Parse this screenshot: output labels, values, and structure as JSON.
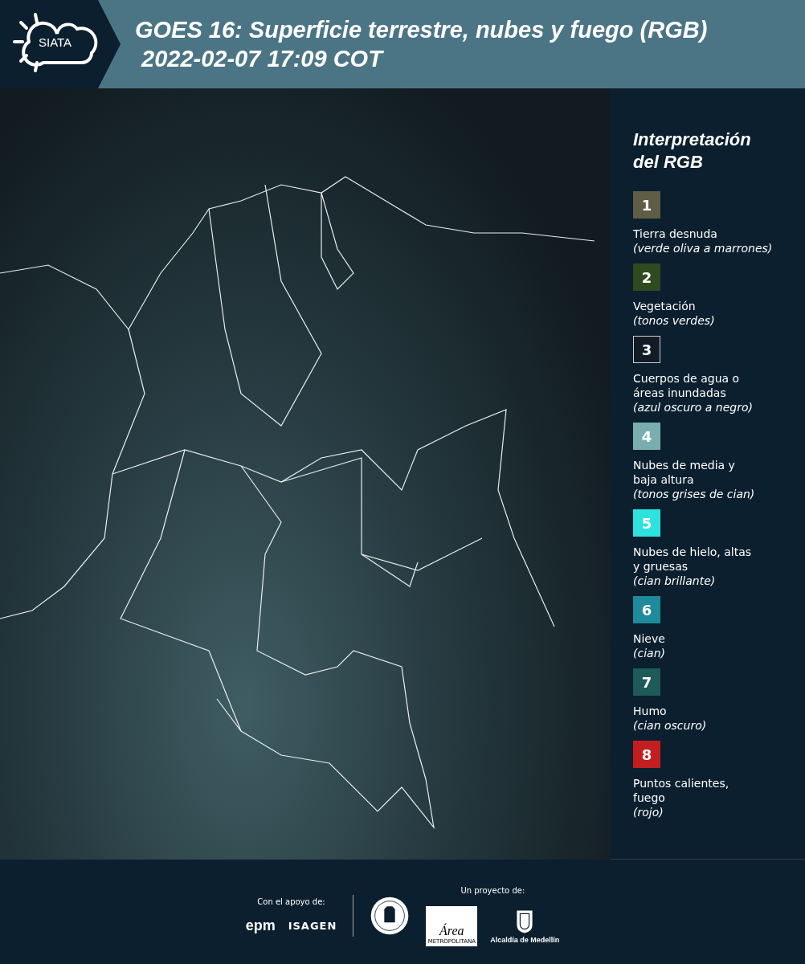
{
  "header": {
    "logo": "SIATA",
    "title": "GOES 16: Superficie terrestre, nubes y fuego (RGB)",
    "timestamp": "2022-02-07 17:09 COT"
  },
  "legend": {
    "title": "Interpretación del RGB",
    "items": [
      {
        "number": "1",
        "color": "#5f5e44",
        "outlined": false,
        "label": "Tierra desnuda",
        "note": "(verde oliva a marrones)"
      },
      {
        "number": "2",
        "color": "#2f4a20",
        "outlined": false,
        "label": "Vegetación",
        "note": "(tonos verdes)"
      },
      {
        "number": "3",
        "color": "#121c26",
        "outlined": true,
        "label": "Cuerpos de agua o áreas inundadas",
        "note": "(azul oscuro a negro)"
      },
      {
        "number": "4",
        "color": "#7aaeae",
        "outlined": false,
        "label": "Nubes de media y baja altura",
        "note": "(tonos grises de cian)"
      },
      {
        "number": "5",
        "color": "#2ee2de",
        "outlined": false,
        "label": "Nubes de hielo, altas y gruesas",
        "note": "(cian brillante)"
      },
      {
        "number": "6",
        "color": "#1e8a9b",
        "outlined": false,
        "label": "Nieve",
        "note": "(cian)"
      },
      {
        "number": "7",
        "color": "#1d5a58",
        "outlined": false,
        "label": "Humo",
        "note": "(cian oscuro)"
      },
      {
        "number": "8",
        "color": "#c31e20",
        "outlined": false,
        "label": "Puntos calientes, fuego",
        "note": "(rojo)"
      }
    ]
  },
  "footer": {
    "support_label": "Con el apoyo de:",
    "supporters": [
      "epm",
      "ISAGEN"
    ],
    "project_label": "Un proyecto de:",
    "area_logo": {
      "title": "Área",
      "subtitle": "METROPOLITANA"
    },
    "city_logo": "Alcaldía de Medellín"
  }
}
